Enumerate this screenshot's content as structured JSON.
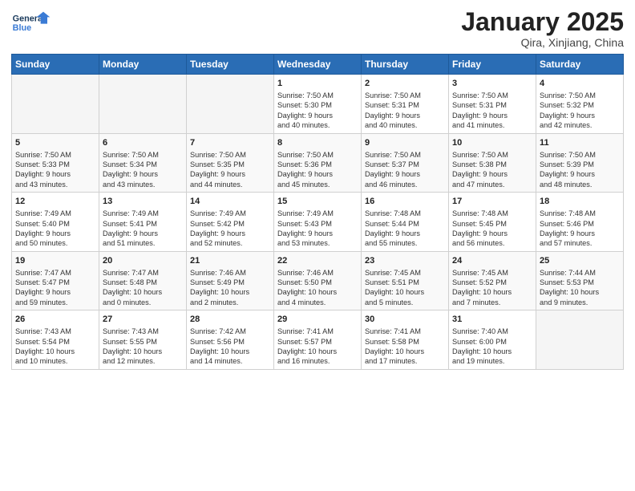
{
  "header": {
    "logo_line1": "General",
    "logo_line2": "Blue",
    "title": "January 2025",
    "subtitle": "Qira, Xinjiang, China"
  },
  "weekdays": [
    "Sunday",
    "Monday",
    "Tuesday",
    "Wednesday",
    "Thursday",
    "Friday",
    "Saturday"
  ],
  "weeks": [
    [
      {
        "day": "",
        "info": ""
      },
      {
        "day": "",
        "info": ""
      },
      {
        "day": "",
        "info": ""
      },
      {
        "day": "1",
        "info": "Sunrise: 7:50 AM\nSunset: 5:30 PM\nDaylight: 9 hours\nand 40 minutes."
      },
      {
        "day": "2",
        "info": "Sunrise: 7:50 AM\nSunset: 5:31 PM\nDaylight: 9 hours\nand 40 minutes."
      },
      {
        "day": "3",
        "info": "Sunrise: 7:50 AM\nSunset: 5:31 PM\nDaylight: 9 hours\nand 41 minutes."
      },
      {
        "day": "4",
        "info": "Sunrise: 7:50 AM\nSunset: 5:32 PM\nDaylight: 9 hours\nand 42 minutes."
      }
    ],
    [
      {
        "day": "5",
        "info": "Sunrise: 7:50 AM\nSunset: 5:33 PM\nDaylight: 9 hours\nand 43 minutes."
      },
      {
        "day": "6",
        "info": "Sunrise: 7:50 AM\nSunset: 5:34 PM\nDaylight: 9 hours\nand 43 minutes."
      },
      {
        "day": "7",
        "info": "Sunrise: 7:50 AM\nSunset: 5:35 PM\nDaylight: 9 hours\nand 44 minutes."
      },
      {
        "day": "8",
        "info": "Sunrise: 7:50 AM\nSunset: 5:36 PM\nDaylight: 9 hours\nand 45 minutes."
      },
      {
        "day": "9",
        "info": "Sunrise: 7:50 AM\nSunset: 5:37 PM\nDaylight: 9 hours\nand 46 minutes."
      },
      {
        "day": "10",
        "info": "Sunrise: 7:50 AM\nSunset: 5:38 PM\nDaylight: 9 hours\nand 47 minutes."
      },
      {
        "day": "11",
        "info": "Sunrise: 7:50 AM\nSunset: 5:39 PM\nDaylight: 9 hours\nand 48 minutes."
      }
    ],
    [
      {
        "day": "12",
        "info": "Sunrise: 7:49 AM\nSunset: 5:40 PM\nDaylight: 9 hours\nand 50 minutes."
      },
      {
        "day": "13",
        "info": "Sunrise: 7:49 AM\nSunset: 5:41 PM\nDaylight: 9 hours\nand 51 minutes."
      },
      {
        "day": "14",
        "info": "Sunrise: 7:49 AM\nSunset: 5:42 PM\nDaylight: 9 hours\nand 52 minutes."
      },
      {
        "day": "15",
        "info": "Sunrise: 7:49 AM\nSunset: 5:43 PM\nDaylight: 9 hours\nand 53 minutes."
      },
      {
        "day": "16",
        "info": "Sunrise: 7:48 AM\nSunset: 5:44 PM\nDaylight: 9 hours\nand 55 minutes."
      },
      {
        "day": "17",
        "info": "Sunrise: 7:48 AM\nSunset: 5:45 PM\nDaylight: 9 hours\nand 56 minutes."
      },
      {
        "day": "18",
        "info": "Sunrise: 7:48 AM\nSunset: 5:46 PM\nDaylight: 9 hours\nand 57 minutes."
      }
    ],
    [
      {
        "day": "19",
        "info": "Sunrise: 7:47 AM\nSunset: 5:47 PM\nDaylight: 9 hours\nand 59 minutes."
      },
      {
        "day": "20",
        "info": "Sunrise: 7:47 AM\nSunset: 5:48 PM\nDaylight: 10 hours\nand 0 minutes."
      },
      {
        "day": "21",
        "info": "Sunrise: 7:46 AM\nSunset: 5:49 PM\nDaylight: 10 hours\nand 2 minutes."
      },
      {
        "day": "22",
        "info": "Sunrise: 7:46 AM\nSunset: 5:50 PM\nDaylight: 10 hours\nand 4 minutes."
      },
      {
        "day": "23",
        "info": "Sunrise: 7:45 AM\nSunset: 5:51 PM\nDaylight: 10 hours\nand 5 minutes."
      },
      {
        "day": "24",
        "info": "Sunrise: 7:45 AM\nSunset: 5:52 PM\nDaylight: 10 hours\nand 7 minutes."
      },
      {
        "day": "25",
        "info": "Sunrise: 7:44 AM\nSunset: 5:53 PM\nDaylight: 10 hours\nand 9 minutes."
      }
    ],
    [
      {
        "day": "26",
        "info": "Sunrise: 7:43 AM\nSunset: 5:54 PM\nDaylight: 10 hours\nand 10 minutes."
      },
      {
        "day": "27",
        "info": "Sunrise: 7:43 AM\nSunset: 5:55 PM\nDaylight: 10 hours\nand 12 minutes."
      },
      {
        "day": "28",
        "info": "Sunrise: 7:42 AM\nSunset: 5:56 PM\nDaylight: 10 hours\nand 14 minutes."
      },
      {
        "day": "29",
        "info": "Sunrise: 7:41 AM\nSunset: 5:57 PM\nDaylight: 10 hours\nand 16 minutes."
      },
      {
        "day": "30",
        "info": "Sunrise: 7:41 AM\nSunset: 5:58 PM\nDaylight: 10 hours\nand 17 minutes."
      },
      {
        "day": "31",
        "info": "Sunrise: 7:40 AM\nSunset: 6:00 PM\nDaylight: 10 hours\nand 19 minutes."
      },
      {
        "day": "",
        "info": ""
      }
    ]
  ]
}
